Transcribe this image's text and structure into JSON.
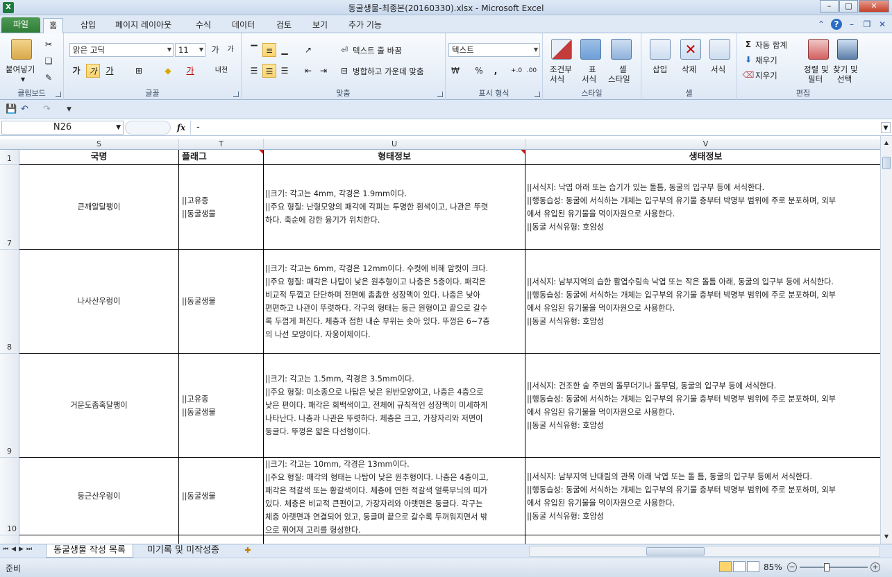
{
  "window": {
    "title": "동굴생물-최종본(20160330).xlsx  -  Microsoft Excel"
  },
  "tabs": [
    "파일",
    "홈",
    "삽입",
    "페이지 레이아웃",
    "수식",
    "데이터",
    "검토",
    "보기",
    "추가 기능"
  ],
  "ribbon": {
    "clipboard": {
      "paste": "붙여넣기",
      "title": "클립보드"
    },
    "font": {
      "name": "맑은 고딕",
      "size": "11",
      "title": "글꼴",
      "bold": "가",
      "italic": "가",
      "underline": "가",
      "grow": "가",
      "shrink": "가",
      "color": "가",
      "phonetic": "내천"
    },
    "align": {
      "wrap": "텍스트 줄 바꿈",
      "merge": "병합하고 가운데 맞춤",
      "title": "맞춤"
    },
    "number": {
      "format": "텍스트",
      "title": "표시 형식",
      "percent": "%",
      "comma": ","
    },
    "styles": {
      "cond": "조건부",
      "cond2": "서식",
      "table": "표",
      "table2": "서식",
      "cell": "셀",
      "cell2": "스타일",
      "title": "스타일"
    },
    "cells": {
      "insert": "삽입",
      "delete": "삭제",
      "format": "서식",
      "title": "셀"
    },
    "editing": {
      "autosum": "자동 합계",
      "fill": "채우기",
      "clear": "지우기",
      "sort": "정렬 및",
      "sort2": "필터",
      "find": "찾기 및",
      "find2": "선택",
      "title": "편집"
    }
  },
  "formula_bar": {
    "name_box": "N26",
    "fx": "fx",
    "value": "-"
  },
  "columns": [
    "S",
    "T",
    "U",
    "V"
  ],
  "header_row": {
    "num": "1",
    "cells": [
      "국명",
      "플래그",
      "형태정보",
      "생태정보"
    ]
  },
  "rows": [
    {
      "num": "7",
      "name": "큰깨알달팽이",
      "flag": [
        "||고유종",
        "||동굴생물"
      ],
      "morph": [
        "||크기: 각고는 4mm, 각경은 1.9mm이다.",
        "||주요 형질: 난형모양의 패각에 각피는 투명한 흰색이고, 나관은 뚜렷",
        "하다. 축순에 강한 융기가 위치한다."
      ],
      "eco": [
        "||서식지: 낙엽 아래 또는 습기가 있는 돌틈, 동굴의 입구부 등에 서식한다.",
        "||행동습성: 동굴에 서식하는 개체는 입구부의 유기물 층부터 박명부 범위에 주로 분포하며, 외부",
        "에서 유입된 유기물을 먹이자원으로 사용한다.",
        "||동굴 서식유형: 호암성"
      ]
    },
    {
      "num": "8",
      "name": "나사산우렁이",
      "flag": [
        "||동굴생물"
      ],
      "morph": [
        "||크기: 각고는 6mm, 각경은 12mm이다. 수컷에 비해 암컷이 크다.",
        "||주요 형질: 패각은 나탑이 낮은 원추형이고 나층은 5층이다. 패각은",
        "비교적 두껍고 단단하며 전면에 촘촘한 성장맥이 있다. 나층은 낮아",
        "편편하고 나관이 뚜렷하다. 각구의 형태는 둥근 원형이고 끝으로 갈수",
        "록 두껍게 퍼진다. 체층과 접한 내순 부위는 솟아 있다. 뚜껑은 6~7층",
        "의 나선 모양이다. 자웅이체이다."
      ],
      "eco": [
        "||서식지: 남부지역의 습한 활엽수림속 낙엽 또는 작은 돌틈 아래, 동굴의 입구부 등에 서식한다.",
        "||행동습성: 동굴에 서식하는 개체는 입구부의 유기물 층부터 박명부 범위에 주로 분포하며, 외부",
        "에서 유입된 유기물을 먹이자원으로 사용한다.",
        "||동굴 서식유형: 호암성"
      ]
    },
    {
      "num": "9",
      "name": "거문도좀혹달팽이",
      "flag": [
        "||고유종",
        "||동굴생물"
      ],
      "morph": [
        "||크기: 각고는 1.5mm, 각경은 3.5mm이다.",
        "||주요 형질: 미소종으로 나탑은 낮은 원반모양이고, 나층은 4층으로",
        "낮은 편이다. 패각은 회백색이고, 전체에 규칙적인 성장맥이 미세하게",
        "나타난다. 나층과 나관은 뚜렷하다. 체층은 크고, 가장자리와 저면이",
        "둥글다. 뚜껑은 얇은 다선형이다."
      ],
      "eco": [
        "||서식지: 건조한 숲 주변의 돌무더기나 돌무덤, 동굴의 입구부 등에 서식한다.",
        "||행동습성: 동굴에 서식하는 개체는 입구부의 유기물 층부터 박명부 범위에 주로 분포하며, 외부",
        "에서 유입된 유기물을 먹이자원으로 사용한다.",
        "||동굴 서식유형: 호암성"
      ]
    },
    {
      "num": "10",
      "name": "둥근산우렁이",
      "flag": [
        "||동굴생물"
      ],
      "morph": [
        "||크기: 각고는 10mm, 각경은 13mm이다.",
        "||주요 형질: 패각의 형태는 나탑이 낮은 원추형이다. 나층은 4층이고,",
        "패각은 적갈색 또는 황갈색이다. 체층에 연한 적갈색 얼룩무늬의 띠가",
        "있다. 체층은 비교적 큰편이고, 가장자리와 아랫면은 둥글다. 각구는",
        "체층 아랫면과 연결되어 있고, 둥글며 끝으로 갈수록 두꺼워지면서 밖",
        "으로 휘어져 고리를 형성한다."
      ],
      "eco": [
        "||서식지: 남부지역 난대림의 관목 아래 낙엽 또는 돌 틈, 동굴의 입구부 등에서 서식한다.",
        "||행동습성: 동굴에 서식하는 개체는 입구부의 유기물 층부터 박명부 범위에 주로 분포하며, 외부",
        "에서 유입된 유기물을 먹이자원으로 사용한다.",
        "||동굴 서식유형: 호암성"
      ]
    }
  ],
  "sheets": [
    "동굴생물 작성 목록",
    "미기록 및 미작성종"
  ],
  "status": {
    "ready": "준비",
    "zoom": "85%"
  }
}
